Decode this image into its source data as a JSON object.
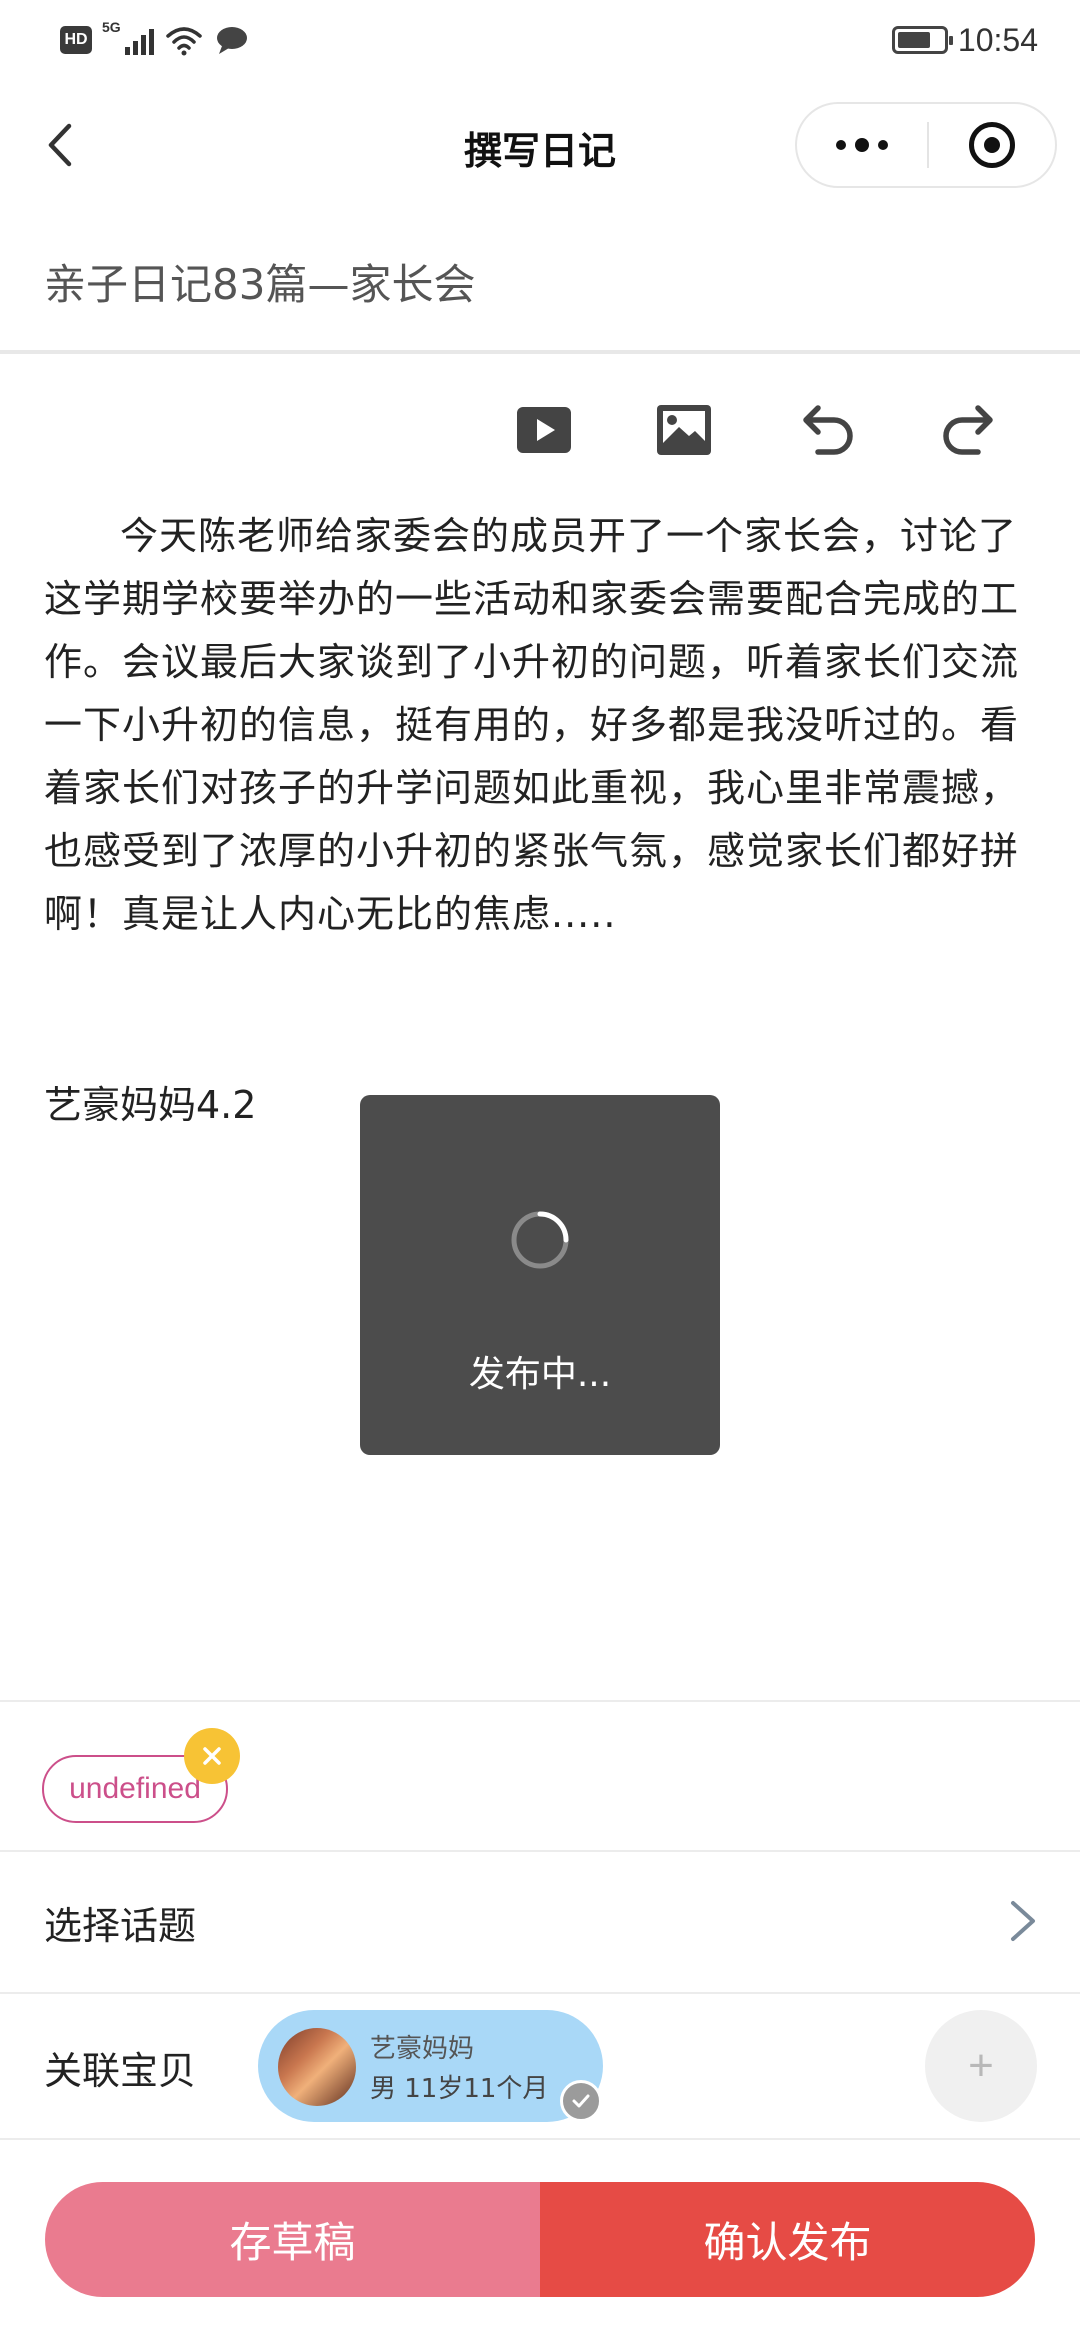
{
  "status_bar": {
    "hd_label": "HD",
    "network_label": "5G",
    "time": "10:54"
  },
  "nav": {
    "title": "撰写日记",
    "back_icon": "chevron-left-icon",
    "more_icon": "more-dots-icon",
    "close_icon": "target-circle-icon"
  },
  "diary": {
    "title": "亲子日记83篇—家长会",
    "body": "今天陈老师给家委会的成员开了一个家长会，讨论了这学期学校要举办的一些活动和家委会需要配合完成的工作。会议最后大家谈到了小升初的问题，听着家长们交流一下小升初的信息，挺有用的，好多都是我没听过的。看着家长们对孩子的升学问题如此重视，我心里非常震撼，也感受到了浓厚的小升初的紧张气氛，感觉家长们都好拼啊！真是让人内心无比的焦虑.....",
    "signature": "艺豪妈妈4.2"
  },
  "toolbar": {
    "icons": [
      "video-icon",
      "image-icon",
      "undo-icon",
      "redo-icon"
    ]
  },
  "toast": {
    "text": "发布中..."
  },
  "tags": {
    "chip_label": "undefined"
  },
  "topic": {
    "label": "选择话题"
  },
  "baby": {
    "label": "关联宝贝",
    "name": "艺豪妈妈",
    "info": "男  11岁11个月",
    "add_symbol": "+"
  },
  "actions": {
    "draft_label": "存草稿",
    "publish_label": "确认发布"
  },
  "colors": {
    "draft_button": "#ea7b8f",
    "publish_button": "#e64b45",
    "tag_accent": "#cc4f8a",
    "tag_remove": "#f7c335",
    "baby_card": "#a9d8f7",
    "toast_bg": "#4c4c4c"
  }
}
